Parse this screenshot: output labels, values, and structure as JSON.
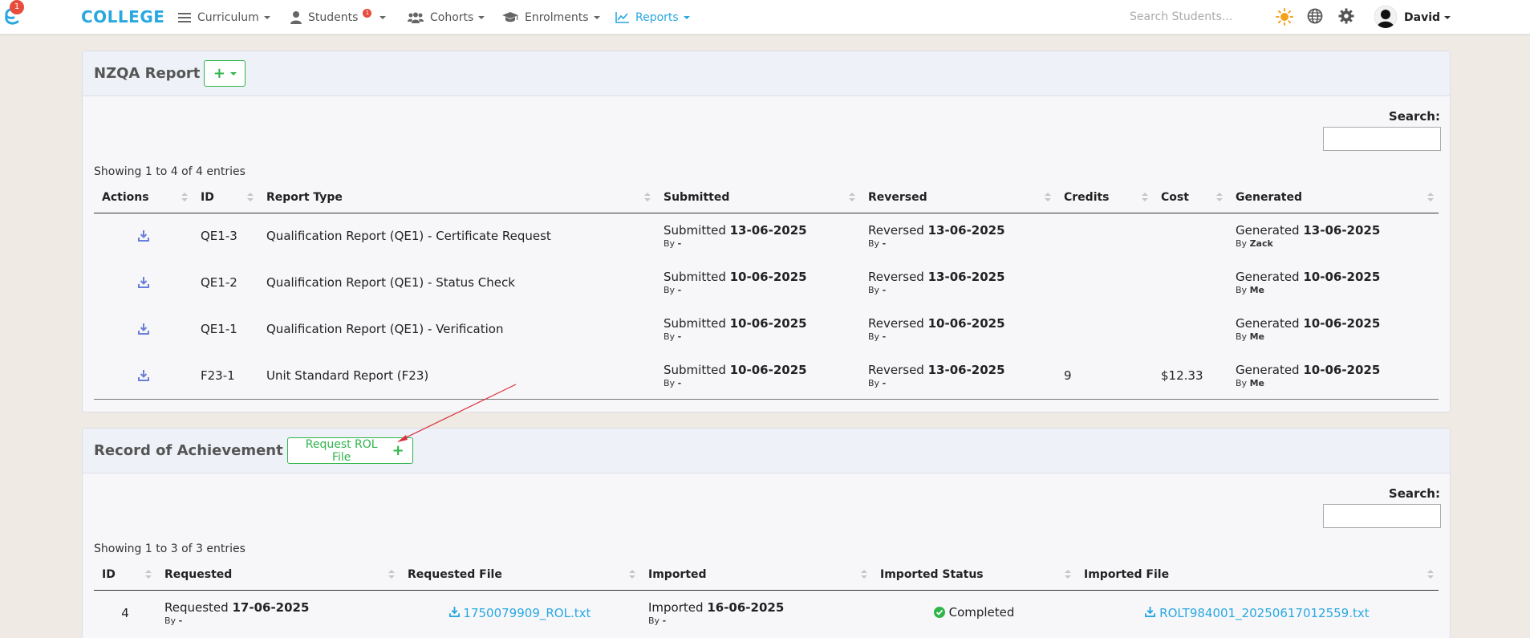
{
  "navbar": {
    "brand_badge": "1",
    "brand_text": "COLLEGE",
    "items": [
      {
        "label": "Curriculum"
      },
      {
        "label": "Students",
        "badge": "1"
      },
      {
        "label": "Cohorts"
      },
      {
        "label": "Enrolments"
      },
      {
        "label": "Reports"
      }
    ],
    "search_placeholder": "Search Students...",
    "user_name": "David"
  },
  "nzqa": {
    "title": "NZQA Report",
    "search_label": "Search:",
    "entries": "Showing 1 to 4 of 4 entries",
    "columns": [
      "Actions",
      "ID",
      "Report Type",
      "Submitted",
      "Reversed",
      "Credits",
      "Cost",
      "Generated"
    ],
    "rows": [
      {
        "id": "QE1-3",
        "type": "Qualification Report (QE1) - Certificate Request",
        "submitted_prefix": "Submitted",
        "submitted_date": "13-06-2025",
        "submitted_by": "-",
        "reversed_prefix": "Reversed",
        "reversed_date": "13-06-2025",
        "reversed_by": "-",
        "credits": "",
        "cost": "",
        "generated_prefix": "Generated",
        "generated_date": "13-06-2025",
        "generated_by": "Zack"
      },
      {
        "id": "QE1-2",
        "type": "Qualification Report (QE1) - Status Check",
        "submitted_prefix": "Submitted",
        "submitted_date": "10-06-2025",
        "submitted_by": "-",
        "reversed_prefix": "Reversed",
        "reversed_date": "13-06-2025",
        "reversed_by": "-",
        "credits": "",
        "cost": "",
        "generated_prefix": "Generated",
        "generated_date": "10-06-2025",
        "generated_by": "Me"
      },
      {
        "id": "QE1-1",
        "type": "Qualification Report (QE1) - Verification",
        "submitted_prefix": "Submitted",
        "submitted_date": "10-06-2025",
        "submitted_by": "-",
        "reversed_prefix": "Reversed",
        "reversed_date": "10-06-2025",
        "reversed_by": "-",
        "credits": "",
        "cost": "",
        "generated_prefix": "Generated",
        "generated_date": "10-06-2025",
        "generated_by": "Me"
      },
      {
        "id": "F23-1",
        "type": "Unit Standard Report (F23)",
        "submitted_prefix": "Submitted",
        "submitted_date": "10-06-2025",
        "submitted_by": "-",
        "reversed_prefix": "Reversed",
        "reversed_date": "13-06-2025",
        "reversed_by": "-",
        "credits": "9",
        "cost": "$12.33",
        "generated_prefix": "Generated",
        "generated_date": "10-06-2025",
        "generated_by": "Me"
      }
    ],
    "by_label": "By"
  },
  "roa": {
    "title": "Record of Achievement",
    "request_button": "Request ROL File",
    "search_label": "Search:",
    "entries": "Showing 1 to 3 of 3 entries",
    "columns": [
      "ID",
      "Requested",
      "Requested File",
      "Imported",
      "Imported Status",
      "Imported File"
    ],
    "rows": [
      {
        "id": "4",
        "requested_prefix": "Requested",
        "requested_date": "17-06-2025",
        "requested_by": "-",
        "requested_file": "1750079909_ROL.txt",
        "imported_prefix": "Imported",
        "imported_date": "16-06-2025",
        "imported_by": "-",
        "status": "Completed",
        "imported_file": "ROLT984001_20250617012559.txt"
      }
    ],
    "by_label": "By"
  },
  "colors": {
    "brand": "#29a8e0",
    "accent_green": "#2fb54a",
    "annotation_arrow": "#d9303a",
    "download_icon": "#6a7fd8"
  },
  "icons": [
    "brand-e-icon",
    "list-icon",
    "user-icon",
    "users-icon",
    "graduation-cap-icon",
    "chart-line-icon",
    "sun-icon",
    "globe-icon",
    "gear-icon",
    "download-icon",
    "check-circle-icon"
  ]
}
